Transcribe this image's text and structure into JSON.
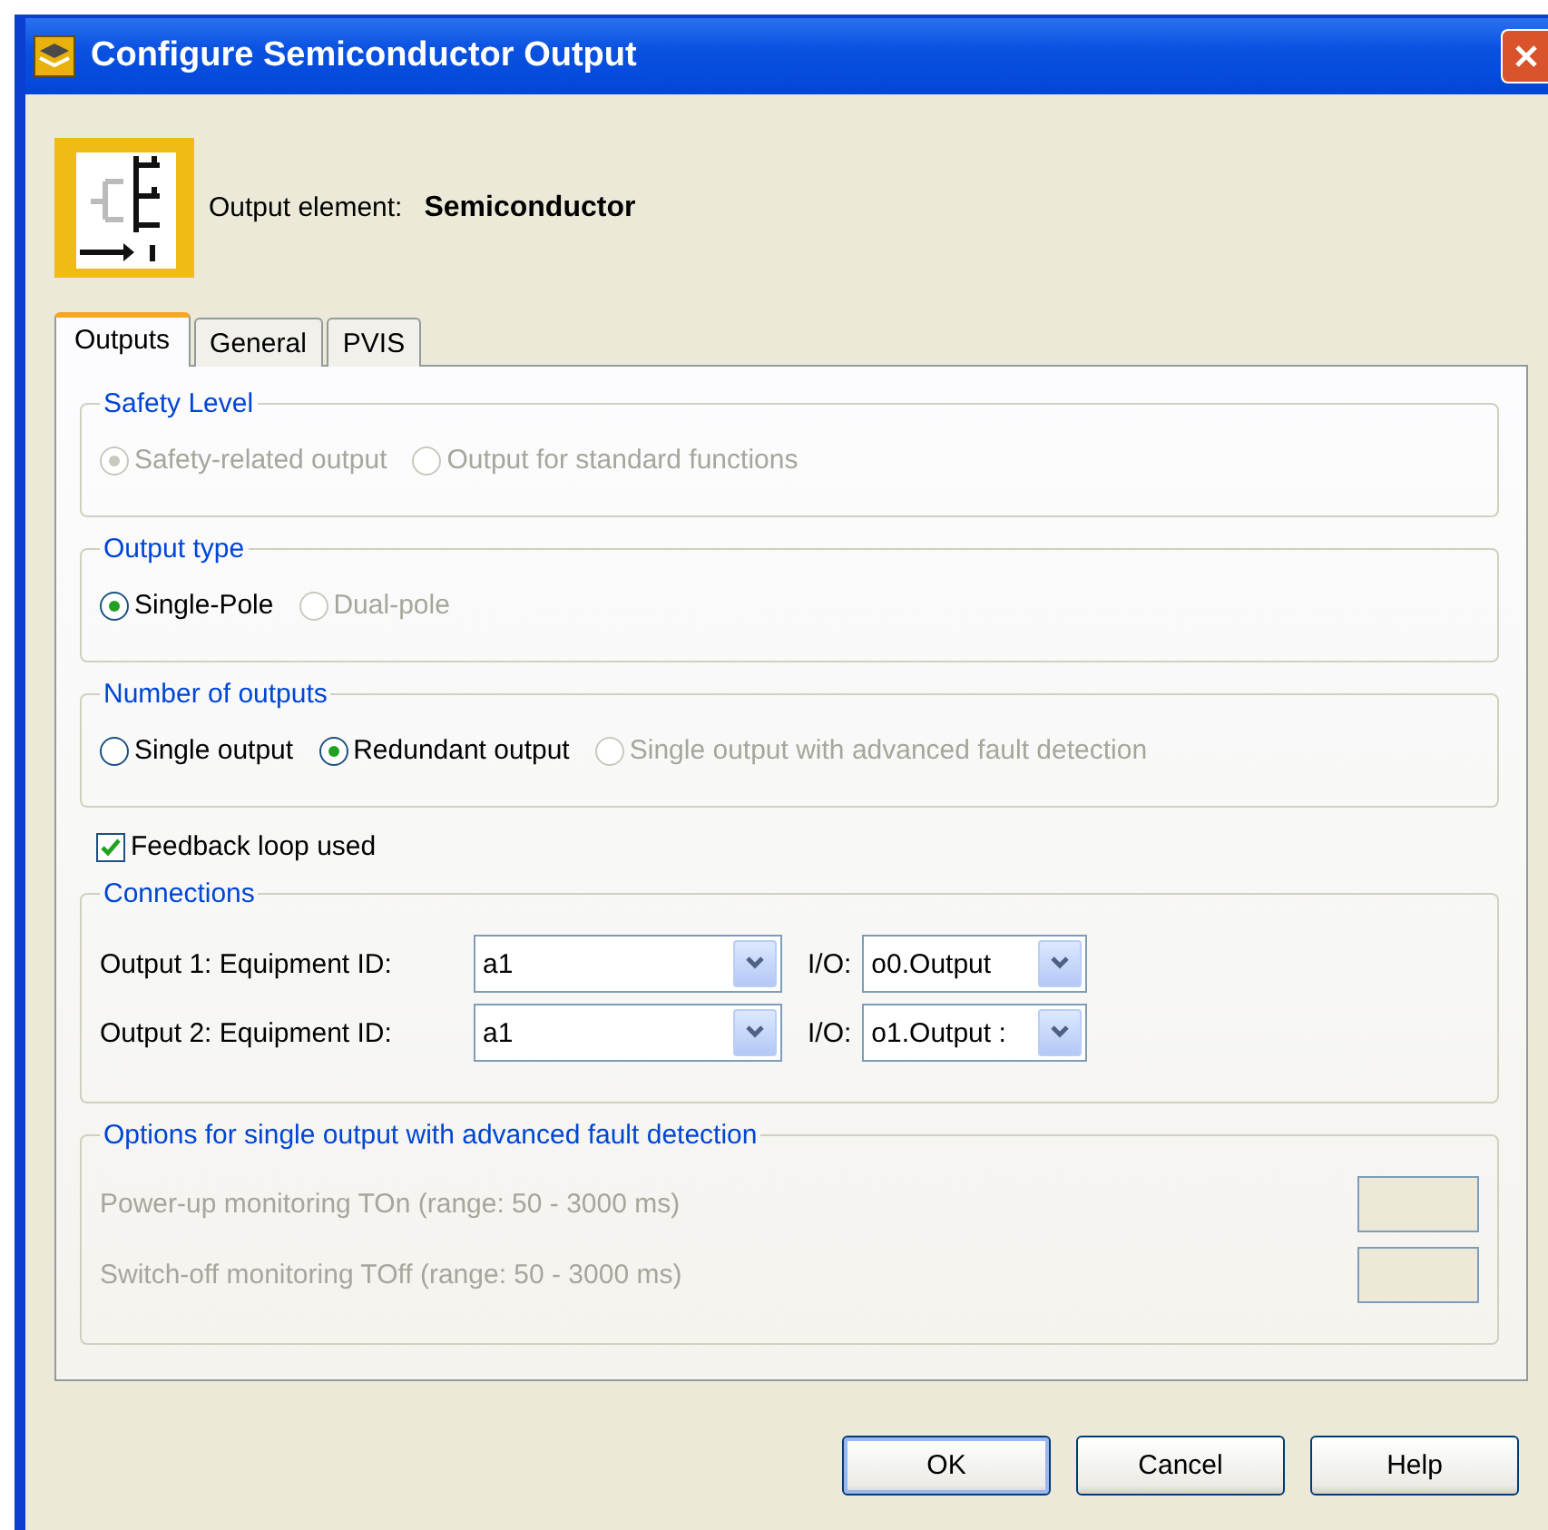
{
  "window": {
    "title": "Configure Semiconductor Output"
  },
  "header": {
    "label": "Output element:",
    "value": "Semiconductor"
  },
  "tabs": [
    {
      "label": "Outputs",
      "selected": true
    },
    {
      "label": "General",
      "selected": false
    },
    {
      "label": "PVIS",
      "selected": false
    }
  ],
  "radio_groups": [
    {
      "title": "Safety Level",
      "options": [
        {
          "label": "Safety-related output",
          "selected": true,
          "disabled": true
        },
        {
          "label": "Output for standard functions",
          "selected": false,
          "disabled": true
        }
      ]
    },
    {
      "title": "Output type",
      "options": [
        {
          "label": "Single-Pole",
          "selected": true,
          "disabled": false
        },
        {
          "label": "Dual-pole",
          "selected": false,
          "disabled": true
        }
      ]
    },
    {
      "title": "Number of outputs",
      "options": [
        {
          "label": "Single output",
          "selected": false,
          "disabled": false
        },
        {
          "label": "Redundant output",
          "selected": true,
          "disabled": false
        },
        {
          "label": "Single output with advanced fault detection",
          "selected": false,
          "disabled": true
        }
      ]
    }
  ],
  "feedback": {
    "label": "Feedback loop used",
    "checked": true
  },
  "connections": {
    "title": "Connections",
    "rows": [
      {
        "label": "Output 1: Equipment ID:",
        "equipment_id": "a1",
        "io_label": "I/O:",
        "io_value": "o0.Output"
      },
      {
        "label": "Output 2: Equipment ID:",
        "equipment_id": "a1",
        "io_label": "I/O:",
        "io_value": "o1.Output :"
      }
    ]
  },
  "advanced_options": {
    "title": "Options for single output with advanced fault detection",
    "disabled": true,
    "fields": [
      {
        "label": "Power-up monitoring TOn (range: 50 - 3000 ms)"
      },
      {
        "label": "Switch-off monitoring TOff (range: 50 - 3000 ms)"
      }
    ]
  },
  "buttons": [
    {
      "label": "OK",
      "default": true
    },
    {
      "label": "Cancel",
      "default": false
    },
    {
      "label": "Help",
      "default": false
    }
  ]
}
